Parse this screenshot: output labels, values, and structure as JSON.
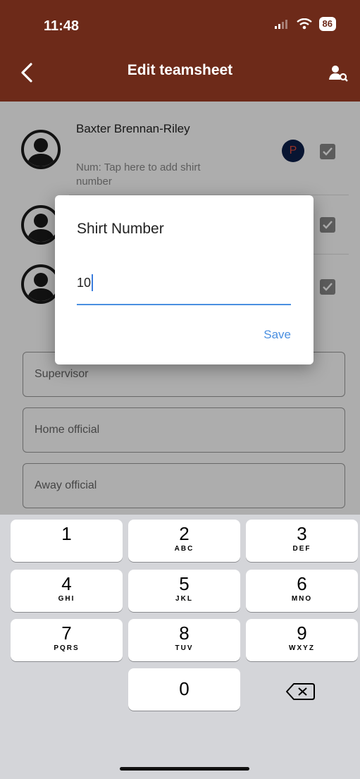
{
  "status_bar": {
    "time": "11:48",
    "battery": "86"
  },
  "header": {
    "title": "Edit teamsheet",
    "back_icon": "chevron-left-icon",
    "action_icon": "person-search-icon",
    "background": "#6d2a19"
  },
  "players": [
    {
      "name": "Baxter Brennan-Riley",
      "hint": "Num: Tap here to add shirt number",
      "badge": "P",
      "checked": true
    },
    {
      "name": "",
      "hint": "",
      "checked": true
    },
    {
      "name": "",
      "hint": "",
      "checked": true
    }
  ],
  "form": {
    "supervisor_placeholder": "Supervisor",
    "home_official_placeholder": "Home official",
    "away_official_placeholder": "Away official"
  },
  "dialog": {
    "title": "Shirt Number",
    "input_value": "10",
    "save_label": "Save",
    "accent": "#4a8fe0"
  },
  "keypad": {
    "keys": [
      {
        "num": "1",
        "letters": ""
      },
      {
        "num": "2",
        "letters": "ABC"
      },
      {
        "num": "3",
        "letters": "DEF"
      },
      {
        "num": "4",
        "letters": "GHI"
      },
      {
        "num": "5",
        "letters": "JKL"
      },
      {
        "num": "6",
        "letters": "MNO"
      },
      {
        "num": "7",
        "letters": "PQRS"
      },
      {
        "num": "8",
        "letters": "TUV"
      },
      {
        "num": "9",
        "letters": "WXYZ"
      },
      {
        "num": "0",
        "letters": ""
      }
    ],
    "delete_icon": "backspace-icon"
  }
}
